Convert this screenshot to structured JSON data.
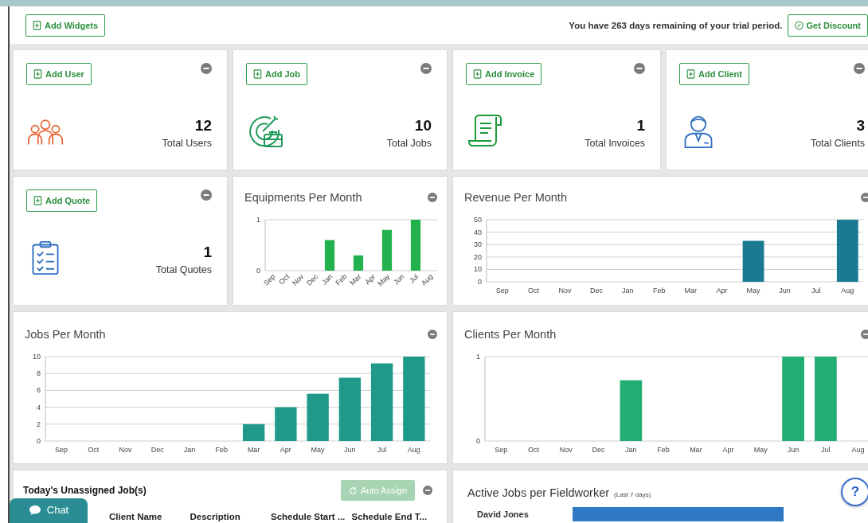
{
  "header": {
    "add_widgets": "Add Widgets",
    "trial_notice": "You have 263 days remaining of your trial period.",
    "get_discount": "Get Discount"
  },
  "stat_cards": [
    {
      "kind": "users",
      "button": "Add User",
      "value": "12",
      "label": "Total Users"
    },
    {
      "kind": "jobs",
      "button": "Add Job",
      "value": "10",
      "label": "Total Jobs"
    },
    {
      "kind": "invoices",
      "button": "Add Invoice",
      "value": "1",
      "label": "Total Invoices"
    },
    {
      "kind": "clients",
      "button": "Add Client",
      "value": "3",
      "label": "Total Clients"
    },
    {
      "kind": "quotes",
      "button": "Add Quote",
      "value": "1",
      "label": "Total Quotes"
    }
  ],
  "chart_panels": [
    {
      "title": "Equipments Per Month",
      "chart_data": {
        "type": "bar",
        "categories": [
          "Sep",
          "Oct",
          "Nov",
          "Dec",
          "Jan",
          "Feb",
          "Mar",
          "Apr",
          "May",
          "Jun",
          "Jul",
          "Aug"
        ],
        "yticks": [
          0,
          1
        ],
        "ylim": [
          0,
          1
        ],
        "grid": true,
        "series": [
          {
            "color": "#22b14c",
            "values": [
              0,
              0,
              0,
              0,
              0.6,
              0,
              0.3,
              0,
              0.8,
              0,
              1,
              0
            ]
          }
        ]
      }
    },
    {
      "title": "Revenue Per Month",
      "chart_data": {
        "type": "bar",
        "categories": [
          "Sep",
          "Oct",
          "Nov",
          "Dec",
          "Jan",
          "Feb",
          "Mar",
          "Apr",
          "May",
          "Jun",
          "Jul",
          "Aug"
        ],
        "yticks": [
          0,
          10,
          20,
          30,
          40,
          50
        ],
        "ylim": [
          0,
          50
        ],
        "grid": true,
        "series": [
          {
            "color": "#1a7a92",
            "values": [
              0,
              0,
              0,
              0,
              0,
              0,
              0,
              0,
              33,
              0,
              0,
              50
            ]
          }
        ]
      }
    },
    {
      "title": "Jobs Per Month",
      "chart_data": {
        "type": "bar",
        "categories": [
          "Sep",
          "Oct",
          "Nov",
          "Dec",
          "Jan",
          "Feb",
          "Mar",
          "Apr",
          "May",
          "Jun",
          "Jul",
          "Aug"
        ],
        "yticks": [
          0,
          2,
          4,
          6,
          8,
          10
        ],
        "ylim": [
          0,
          10
        ],
        "grid": true,
        "series": [
          {
            "color": "#1f9a8a",
            "values": [
              0,
              0,
              0,
              0,
              0,
              0,
              2,
              4,
              5.6,
              7.5,
              9.2,
              10
            ]
          }
        ]
      }
    },
    {
      "title": "Clients Per Month",
      "chart_data": {
        "type": "bar",
        "categories": [
          "Sep",
          "Oct",
          "Nov",
          "Dec",
          "Jan",
          "Feb",
          "Mar",
          "Apr",
          "May",
          "Jun",
          "Jul",
          "Aug"
        ],
        "yticks": [
          0,
          1
        ],
        "ylim": [
          0,
          1
        ],
        "grid": true,
        "series": [
          {
            "color": "#22ad73",
            "values": [
              0,
              0,
              0,
              0,
              0.72,
              0,
              0,
              0,
              0,
              1,
              1,
              0
            ]
          }
        ]
      }
    }
  ],
  "unassigned_jobs": {
    "title": "Today's Unassigned Job(s)",
    "auto_assign": {
      "label": "Auto Assign",
      "disabled": true
    },
    "columns": [
      "Client Name",
      "Description",
      "Schedule Start ...",
      "Schedule End T..."
    ]
  },
  "active_jobs": {
    "title": "Active Jobs per Fieldworker",
    "subtitle": "(Last 7 days)",
    "rows": [
      {
        "name": "David Jones"
      }
    ]
  },
  "chat_button": "Chat",
  "help_button": "?"
}
